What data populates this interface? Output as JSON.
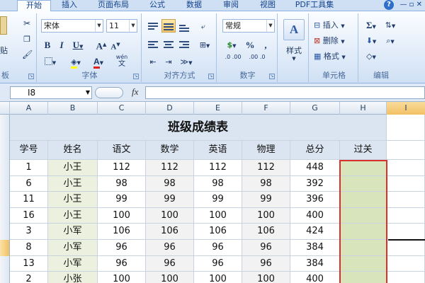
{
  "tabs": [
    "开始",
    "插入",
    "页面布局",
    "公式",
    "数据",
    "审阅",
    "视图",
    "PDF工具集"
  ],
  "window_buttons": "— ▫ ✕",
  "ribbon": {
    "clipboard": {
      "paste": "贴",
      "label": "板"
    },
    "font": {
      "name": "宋体",
      "size": "11",
      "bold": "B",
      "italic": "I",
      "underline": "U",
      "grow": "A",
      "shrink": "A",
      "wen": "wén",
      "label": "字体"
    },
    "alignment": {
      "label": "对齐方式"
    },
    "number": {
      "format": "常规",
      "currency": "$",
      "percent": "%",
      "comma": ",",
      "inc": ".0 .00",
      "dec": ".00 .0",
      "label": "数字"
    },
    "styles": {
      "label": "样式"
    },
    "cells": {
      "insert": "插入",
      "delete": "删除",
      "format": "格式",
      "label": "单元格"
    },
    "editing": {
      "sum": "Σ",
      "label": "编辑"
    }
  },
  "formula_bar": {
    "name_box": "I8",
    "fx": "fx",
    "value": ""
  },
  "columns": [
    "A",
    "B",
    "C",
    "D",
    "E",
    "F",
    "G",
    "H",
    "I"
  ],
  "sheet": {
    "title": "班级成绩表",
    "headers": [
      "学号",
      "姓名",
      "语文",
      "数学",
      "英语",
      "物理",
      "总分",
      "过关"
    ],
    "rows": [
      [
        "1",
        "小王",
        "112",
        "112",
        "112",
        "112",
        "448",
        ""
      ],
      [
        "6",
        "小王",
        "98",
        "98",
        "98",
        "98",
        "392",
        ""
      ],
      [
        "11",
        "小王",
        "99",
        "99",
        "99",
        "99",
        "396",
        ""
      ],
      [
        "16",
        "小王",
        "100",
        "100",
        "100",
        "100",
        "400",
        ""
      ],
      [
        "3",
        "小军",
        "106",
        "106",
        "106",
        "106",
        "424",
        ""
      ],
      [
        "8",
        "小军",
        "96",
        "96",
        "96",
        "96",
        "384",
        ""
      ],
      [
        "13",
        "小军",
        "96",
        "96",
        "96",
        "96",
        "384",
        ""
      ],
      [
        "2",
        "小张",
        "100",
        "100",
        "100",
        "100",
        "400",
        ""
      ]
    ]
  },
  "colors": {
    "header_blue": "#dbe5f1",
    "name_green": "#ebf1de",
    "score_gray": "#f2f2f2",
    "pass_green": "#d7e4bc",
    "selection_red": "#d9302c"
  }
}
